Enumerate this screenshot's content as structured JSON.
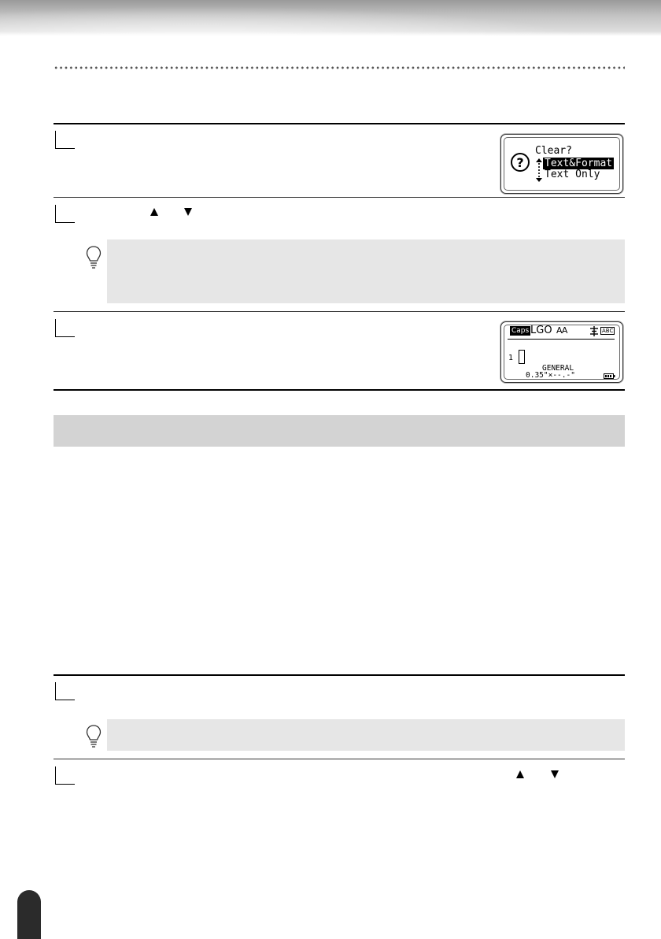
{
  "dialog_clear": {
    "title": "Clear?",
    "selected_option": "Text&Format",
    "other_option": "Text Only"
  },
  "status_screen": {
    "caps_badge": "Caps",
    "indicators": "LGO",
    "size_indicator": "AA",
    "abc_badge": "ABC",
    "line_number": "1",
    "style_name": "GENERAL",
    "tape_spec": "0.35\"×--.-\""
  },
  "colors": {
    "note_background": "#e6e6e6",
    "heading_band": "#d3d3d3",
    "page_tab": "#2b2b2b"
  },
  "icons": [
    "arrow-up-key-icon",
    "arrow-down-key-icon",
    "lightbulb-hint-icon",
    "question-circle-icon",
    "battery-icon"
  ]
}
